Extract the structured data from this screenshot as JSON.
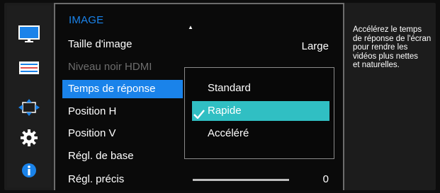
{
  "menu": {
    "title": "IMAGE",
    "items": [
      {
        "label": "Taille d'image",
        "value": "Large",
        "state": "normal"
      },
      {
        "label": "Niveau noir HDMI",
        "value": "",
        "state": "disabled"
      },
      {
        "label": "Temps de réponse",
        "value": "",
        "state": "selected"
      },
      {
        "label": "Position H",
        "value": "",
        "state": "normal"
      },
      {
        "label": "Position V",
        "value": "",
        "state": "normal"
      },
      {
        "label": "Régl. de base",
        "value": "",
        "state": "normal"
      },
      {
        "label": "Régl. précis",
        "value": "0",
        "state": "normal"
      }
    ]
  },
  "submenu": {
    "options": [
      "Standard",
      "Rapide",
      "Accéléré"
    ],
    "selected": "Rapide"
  },
  "help": {
    "text": "Accélérez le temps\nde réponse de l'écran\npour rendre les\nvidéos plus nettes\net naturelles."
  },
  "sidebar": {
    "icons": [
      "monitor-icon",
      "picture-settings-icon",
      "arrows-move-icon",
      "gear-icon",
      "info-icon"
    ],
    "active": "monitor-icon"
  },
  "colors": {
    "accent_blue": "#1a83ea",
    "selection_teal": "#30bfc3",
    "background": "#0a0a0a",
    "disabled_text": "#6d6d6d"
  }
}
